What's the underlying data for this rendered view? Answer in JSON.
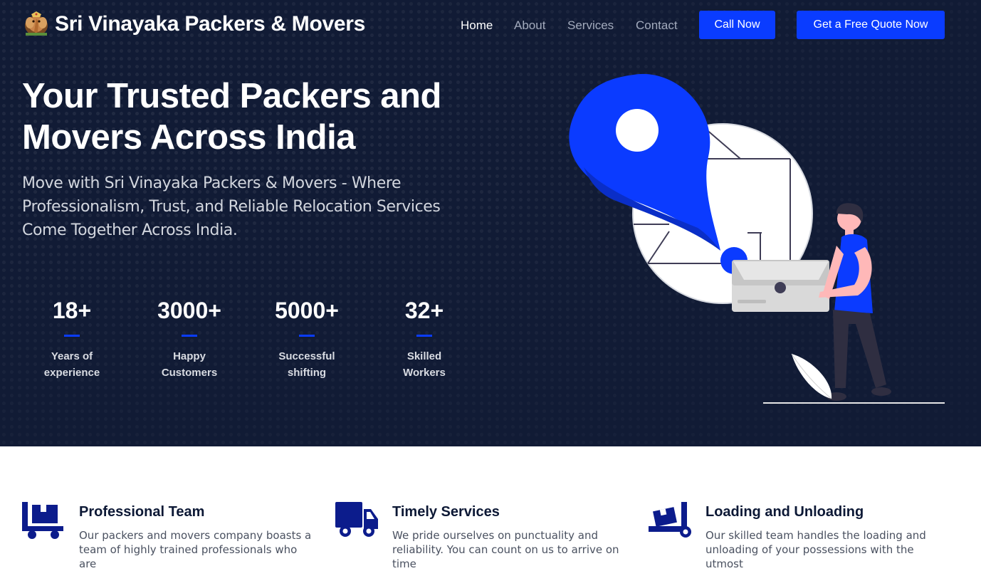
{
  "header": {
    "brand": "Sri Vinayaka Packers & Movers",
    "logo_icon": "ganesha-logo-icon"
  },
  "nav": {
    "items": [
      "Home",
      "About",
      "Services",
      "Contact"
    ],
    "active": "Home"
  },
  "buttons": {
    "call": "Call Now",
    "quote": "Get a Free Quote Now"
  },
  "hero": {
    "headline_line1": "Your Trusted Packers and",
    "headline_line2": "Movers Across India",
    "subtext": "Move with Sri Vinayaka Packers & Movers - Where Professionalism, Trust, and Reliable Relocation Services Come Together Across India.",
    "illustration": "location-pin-person-with-box-illustration"
  },
  "stats": [
    {
      "value": "18+",
      "label": "Years of experience"
    },
    {
      "value": "3000+",
      "label": "Happy Customers"
    },
    {
      "value": "5000+",
      "label": "Successful shifting"
    },
    {
      "value": "32+",
      "label": "Skilled Workers"
    }
  ],
  "features": [
    {
      "icon": "cart-with-boxes-icon",
      "title": "Professional Team",
      "desc": "Our packers and movers company boasts a team of highly trained professionals who are"
    },
    {
      "icon": "truck-icon",
      "title": "Timely Services",
      "desc": "We pride ourselves on punctuality and reliability. You can count on us to arrive on time"
    },
    {
      "icon": "hand-truck-icon",
      "title": "Loading and Unloading",
      "desc": "Our skilled team handles the loading and unloading of your possessions with the utmost"
    }
  ],
  "colors": {
    "hero_bg": "#111b35",
    "accent": "#0a3cff",
    "icon_navy": "#0c1c8c"
  }
}
